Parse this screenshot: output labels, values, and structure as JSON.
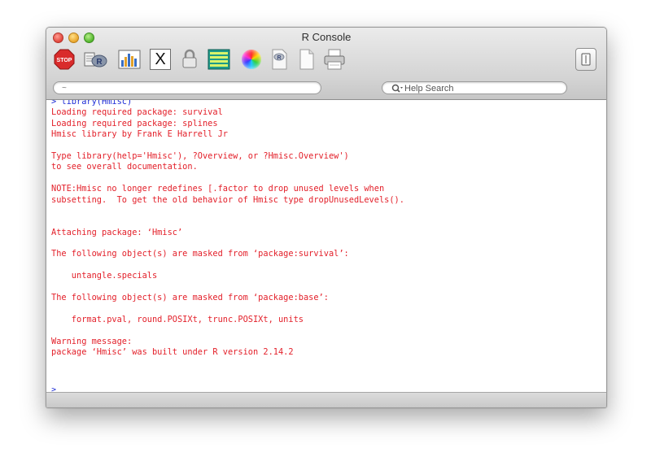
{
  "window": {
    "title": "R Console"
  },
  "toolbar": {
    "tools": [
      {
        "icon": "stop-icon",
        "label": "STOP"
      },
      {
        "icon": "source-script-icon"
      },
      {
        "icon": "quartz-graphics-icon"
      },
      {
        "icon": "x11-icon",
        "label": "X"
      },
      {
        "icon": "lock-icon"
      },
      {
        "icon": "package-manager-icon"
      },
      {
        "icon": "color-wheel-icon"
      },
      {
        "icon": "r-document-icon"
      },
      {
        "icon": "new-document-icon"
      },
      {
        "icon": "print-icon"
      }
    ],
    "right_tool_icon": "sidebar-toggle-icon"
  },
  "path_field": {
    "value": "~"
  },
  "help_search": {
    "placeholder": "Help Search"
  },
  "console": {
    "lines": [
      {
        "kind": "cmd",
        "text": "> library(Hmisc)"
      },
      {
        "kind": "out",
        "text": "Loading required package: survival"
      },
      {
        "kind": "out",
        "text": "Loading required package: splines"
      },
      {
        "kind": "out",
        "text": "Hmisc library by Frank E Harrell Jr"
      },
      {
        "kind": "out",
        "text": ""
      },
      {
        "kind": "out",
        "text": "Type library(help='Hmisc'), ?Overview, or ?Hmisc.Overview')"
      },
      {
        "kind": "out",
        "text": "to see overall documentation."
      },
      {
        "kind": "out",
        "text": ""
      },
      {
        "kind": "out",
        "text": "NOTE:Hmisc no longer redefines [.factor to drop unused levels when"
      },
      {
        "kind": "out",
        "text": "subsetting.  To get the old behavior of Hmisc type dropUnusedLevels()."
      },
      {
        "kind": "out",
        "text": ""
      },
      {
        "kind": "out",
        "text": ""
      },
      {
        "kind": "out",
        "text": "Attaching package: ‘Hmisc’"
      },
      {
        "kind": "out",
        "text": ""
      },
      {
        "kind": "out",
        "text": "The following object(s) are masked from ‘package:survival’:"
      },
      {
        "kind": "out",
        "text": ""
      },
      {
        "kind": "out",
        "text": "    untangle.specials"
      },
      {
        "kind": "out",
        "text": ""
      },
      {
        "kind": "out",
        "text": "The following object(s) are masked from ‘package:base’:"
      },
      {
        "kind": "out",
        "text": ""
      },
      {
        "kind": "out",
        "text": "    format.pval, round.POSIXt, trunc.POSIXt, units"
      },
      {
        "kind": "out",
        "text": ""
      },
      {
        "kind": "out",
        "text": "Warning message:"
      },
      {
        "kind": "out",
        "text": "package ‘Hmisc’ was built under R version 2.14.2"
      }
    ],
    "prompt": ">"
  },
  "colors": {
    "command": "#1c2bd6",
    "output": "#e3202a"
  }
}
